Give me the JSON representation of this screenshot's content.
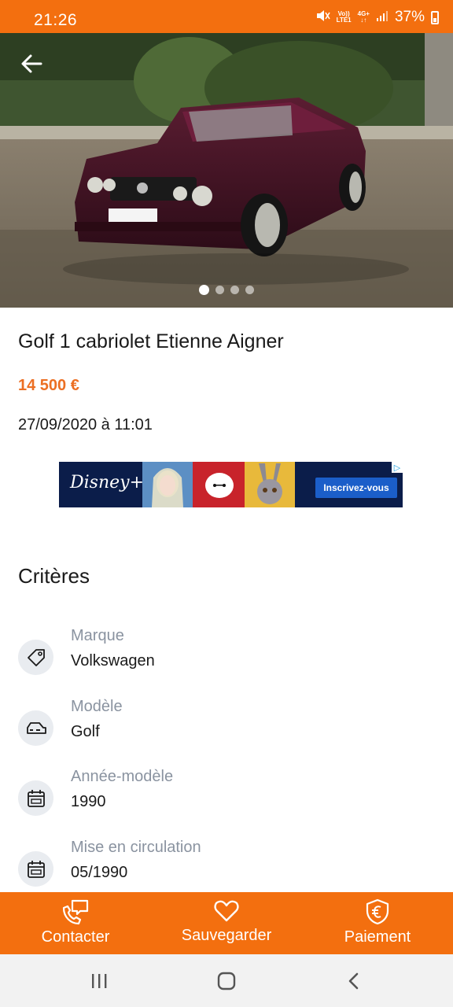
{
  "status_bar": {
    "time": "21:26",
    "net_line1": "Vo))",
    "net_line2": "LTE1",
    "net_gen": "4G+",
    "battery": "37%"
  },
  "hero": {
    "photo_count": 4,
    "active_photo": 1
  },
  "listing": {
    "title": "Golf 1 cabriolet Etienne Aigner",
    "price": "14 500 €",
    "date": "27/09/2020 à 11:01"
  },
  "ad": {
    "brand": "Disney+",
    "cta": "Inscrivez-vous",
    "choice": "▷"
  },
  "criteria": {
    "heading": "Critères",
    "items": [
      {
        "label": "Marque",
        "value": "Volkswagen",
        "icon": "tag-icon"
      },
      {
        "label": "Modèle",
        "value": "Golf",
        "icon": "car-icon"
      },
      {
        "label": "Année-modèle",
        "value": "1990",
        "icon": "calendar-icon"
      },
      {
        "label": "Mise en circulation",
        "value": "05/1990",
        "icon": "calendar-icon"
      }
    ]
  },
  "actions": {
    "contact": "Contacter",
    "save": "Sauvegarder",
    "payment": "Paiement"
  },
  "colors": {
    "brand_orange": "#f36f0f",
    "price_orange": "#ec6f23",
    "label_gray": "#8a93a0"
  }
}
